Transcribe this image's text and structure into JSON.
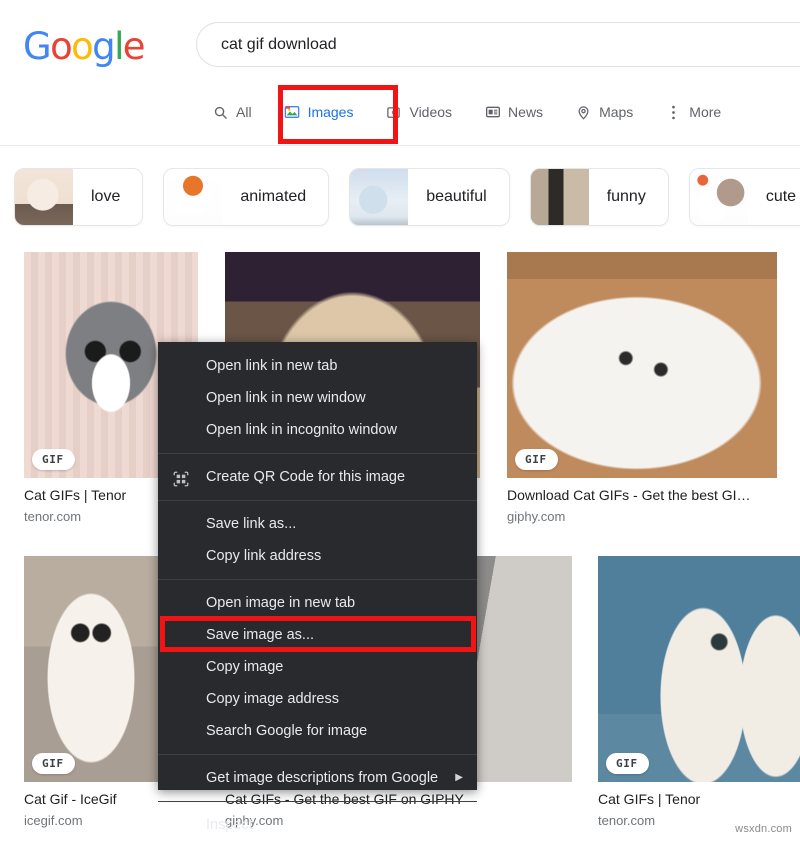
{
  "header": {
    "logo_text": "Google",
    "logo_letters": [
      {
        "ch": "G",
        "color": "#4285F4"
      },
      {
        "ch": "o",
        "color": "#EA4335"
      },
      {
        "ch": "o",
        "color": "#FBBC05"
      },
      {
        "ch": "g",
        "color": "#4285F4"
      },
      {
        "ch": "l",
        "color": "#34A853"
      },
      {
        "ch": "e",
        "color": "#EA4335"
      }
    ],
    "search": {
      "value": "cat gif download",
      "placeholder": "Search"
    }
  },
  "tabs": [
    {
      "label": "All",
      "icon": "search-icon",
      "active": false
    },
    {
      "label": "Images",
      "icon": "images-icon",
      "active": true
    },
    {
      "label": "Videos",
      "icon": "video-icon",
      "active": false
    },
    {
      "label": "News",
      "icon": "news-icon",
      "active": false
    },
    {
      "label": "Maps",
      "icon": "map-pin-icon",
      "active": false
    },
    {
      "label": "More",
      "icon": "kebab-menu-icon",
      "active": false
    }
  ],
  "chips": [
    {
      "label": "love"
    },
    {
      "label": "animated"
    },
    {
      "label": "beautiful"
    },
    {
      "label": "funny"
    },
    {
      "label": "cute"
    }
  ],
  "results": [
    {
      "title": "Cat GIFs | Tenor",
      "source": "tenor.com",
      "badge": "GIF"
    },
    {
      "title": "",
      "source": "",
      "badge": ""
    },
    {
      "title": "Download Cat GIFs - Get the best GI…",
      "source": "giphy.com",
      "badge": "GIF"
    },
    {
      "title": "Cat Gif - IceGif",
      "source": "icegif.com",
      "badge": "GIF"
    },
    {
      "title": "Cat GIFs - Get the best GIF on GIPHY",
      "source": "giphy.com",
      "badge": ""
    },
    {
      "title": "Cat GIFs | Tenor",
      "source": "tenor.com",
      "badge": "GIF"
    }
  ],
  "context_menu": {
    "items": [
      {
        "label": "Open link in new tab",
        "icon": null,
        "submenu": false
      },
      {
        "label": "Open link in new window",
        "icon": null,
        "submenu": false
      },
      {
        "label": "Open link in incognito window",
        "icon": null,
        "submenu": false
      },
      {
        "separator": true
      },
      {
        "label": "Create QR Code for this image",
        "icon": "qr-code-icon",
        "submenu": false
      },
      {
        "separator": true
      },
      {
        "label": "Save link as...",
        "icon": null,
        "submenu": false
      },
      {
        "label": "Copy link address",
        "icon": null,
        "submenu": false
      },
      {
        "separator": true
      },
      {
        "label": "Open image in new tab",
        "icon": null,
        "submenu": false
      },
      {
        "label": "Save image as...",
        "icon": null,
        "submenu": false,
        "highlighted": true
      },
      {
        "label": "Copy image",
        "icon": null,
        "submenu": false
      },
      {
        "label": "Copy image address",
        "icon": null,
        "submenu": false
      },
      {
        "label": "Search Google for image",
        "icon": null,
        "submenu": false
      },
      {
        "separator": true
      },
      {
        "label": "Get image descriptions from Google",
        "icon": null,
        "submenu": true
      },
      {
        "separator": true
      },
      {
        "label": "Inspect",
        "icon": null,
        "submenu": false
      }
    ],
    "submenu_arrow": "▶"
  },
  "annotations": {
    "highlight_color": "#f01414",
    "images_tab_highlight": "Images",
    "save_image_highlight": "Save image as..."
  },
  "watermark": "wsxdn.com",
  "colors": {
    "accent_blue": "#1a73e8",
    "text_primary": "#202124",
    "text_secondary": "#70757a",
    "menu_bg": "#292a2d",
    "menu_text": "#e8eaed"
  }
}
